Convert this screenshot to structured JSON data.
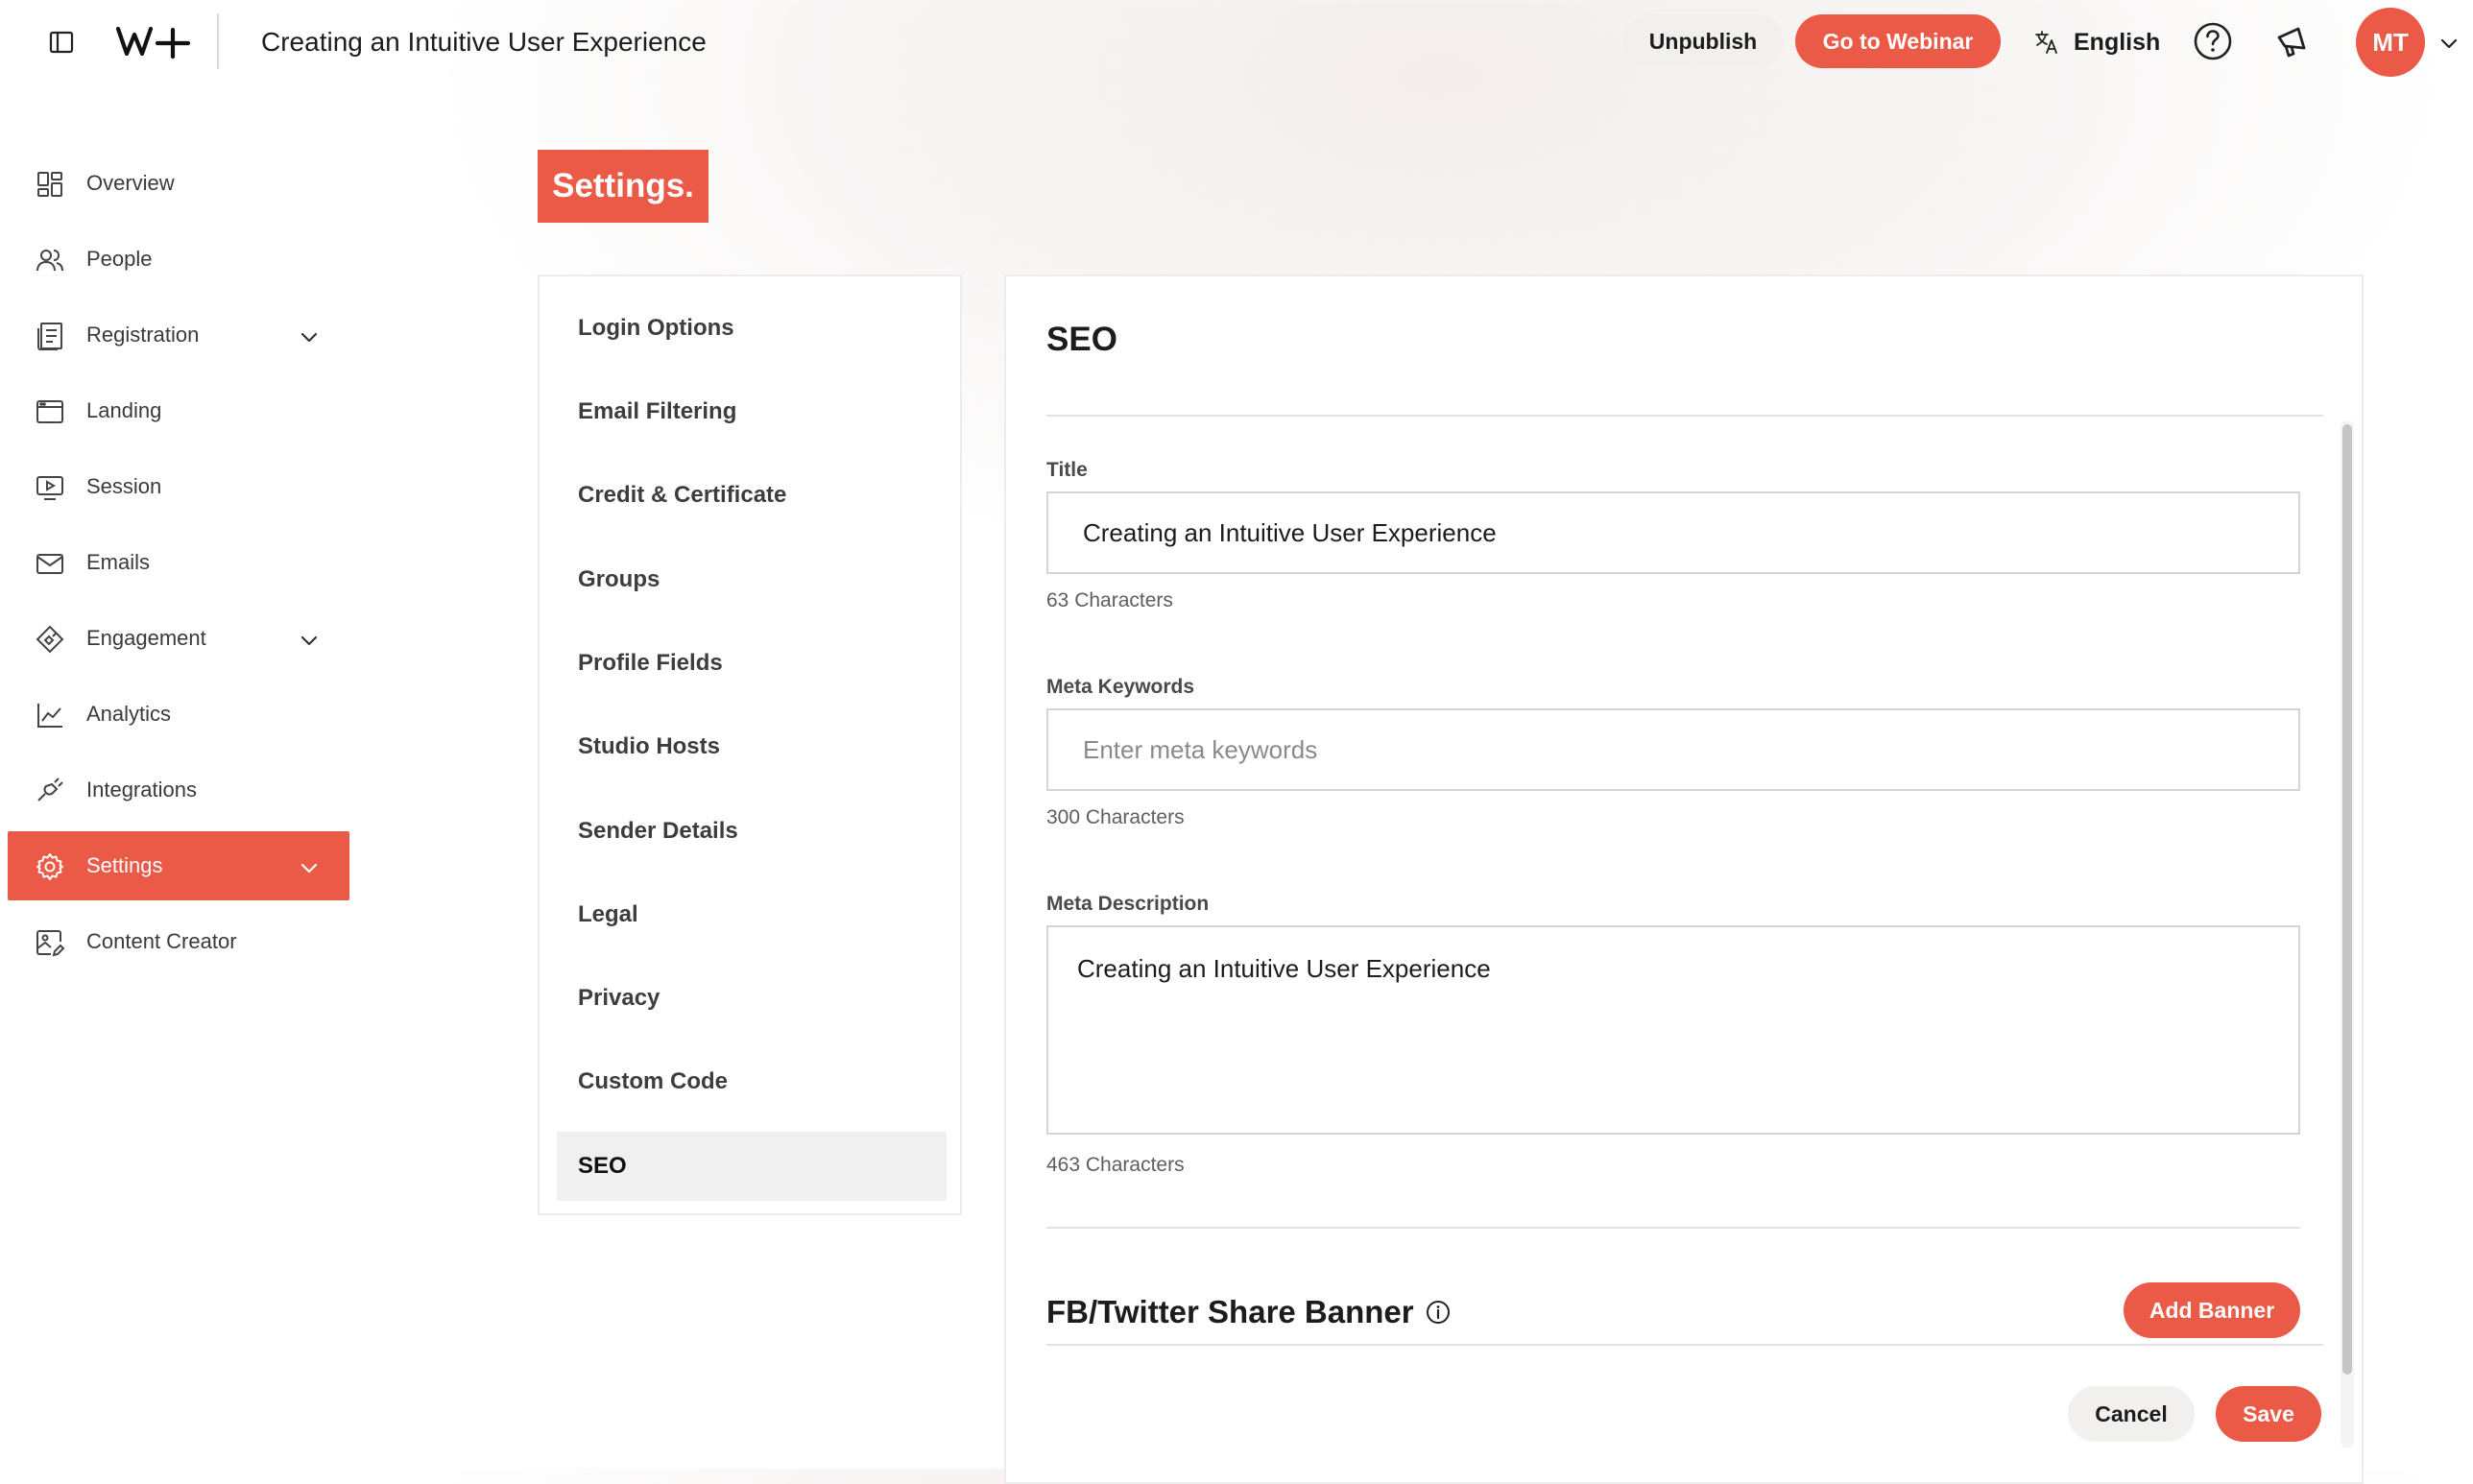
{
  "topbar": {
    "page_title": "Creating an Intuitive User Experience",
    "unpublish_label": "Unpublish",
    "go_to_webinar_label": "Go to Webinar",
    "language_label": "English",
    "avatar_initials": "MT",
    "logo_text": "W+",
    "icons": [
      "sidebar-toggle-icon",
      "translate-icon",
      "help-icon",
      "megaphone-icon",
      "chevron-down-icon"
    ]
  },
  "sidebar": {
    "items": [
      {
        "label": "Overview",
        "icon": "grid-icon"
      },
      {
        "label": "People",
        "icon": "people-icon"
      },
      {
        "label": "Registration",
        "icon": "registration-icon",
        "expandable": true
      },
      {
        "label": "Landing",
        "icon": "landing-icon"
      },
      {
        "label": "Session",
        "icon": "session-play-icon"
      },
      {
        "label": "Emails",
        "icon": "mail-icon"
      },
      {
        "label": "Engagement",
        "icon": "engagement-icon",
        "expandable": true
      },
      {
        "label": "Analytics",
        "icon": "chart-icon"
      },
      {
        "label": "Integrations",
        "icon": "plug-icon"
      },
      {
        "label": "Settings",
        "icon": "gear-icon",
        "expandable": true,
        "active": true
      },
      {
        "label": "Content Creator",
        "icon": "image-edit-icon"
      }
    ]
  },
  "settings_heading": "Settings.",
  "settings_nav": {
    "items": [
      {
        "label": "Login Options"
      },
      {
        "label": "Email Filtering"
      },
      {
        "label": "Credit & Certificate"
      },
      {
        "label": "Groups"
      },
      {
        "label": "Profile Fields"
      },
      {
        "label": "Studio Hosts"
      },
      {
        "label": "Sender Details"
      },
      {
        "label": "Legal"
      },
      {
        "label": "Privacy"
      },
      {
        "label": "Custom Code"
      },
      {
        "label": "SEO",
        "active": true
      }
    ]
  },
  "seo": {
    "heading": "SEO",
    "title_label": "Title",
    "title_value": "Creating an Intuitive User Experience",
    "title_count": "63 Characters",
    "keywords_label": "Meta Keywords",
    "keywords_value": "",
    "keywords_placeholder": "Enter meta keywords",
    "keywords_count": "300 Characters",
    "description_label": "Meta Description",
    "description_value": "Creating an Intuitive User Experience",
    "description_count": "463 Characters",
    "banner_heading": "FB/Twitter Share Banner",
    "add_banner_label": "Add Banner",
    "cancel_label": "Cancel",
    "save_label": "Save"
  },
  "colors": {
    "accent": "#eb5a46",
    "button_neutral": "#f1f0ef"
  }
}
